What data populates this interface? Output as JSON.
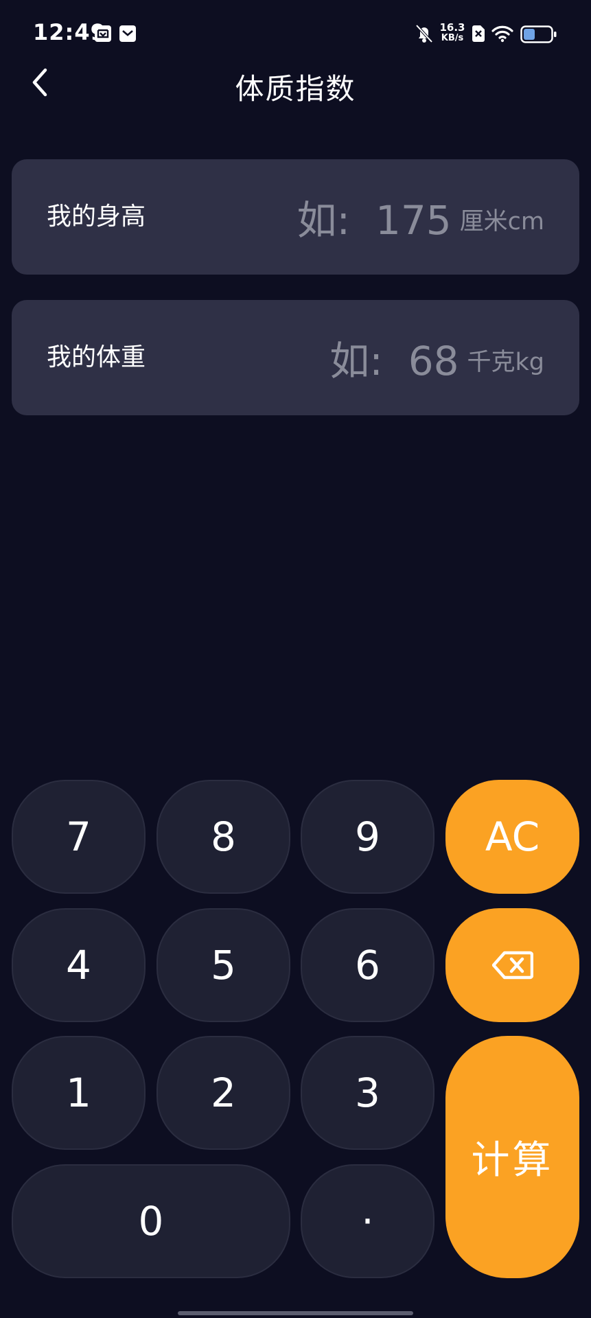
{
  "status_bar": {
    "time": "12:49",
    "net_speed_value": "16.3",
    "net_speed_unit": "KB/s"
  },
  "header": {
    "title": "体质指数"
  },
  "inputs": {
    "height": {
      "label": "我的身高",
      "placeholder": "如:  175",
      "unit": "厘米cm"
    },
    "weight": {
      "label": "我的体重",
      "placeholder": "如:  68",
      "unit": "千克kg"
    }
  },
  "keypad": {
    "keys": {
      "k7": "7",
      "k8": "8",
      "k9": "9",
      "ac": "AC",
      "k4": "4",
      "k5": "5",
      "k6": "6",
      "k1": "1",
      "k2": "2",
      "k3": "3",
      "k0": "0",
      "dot": "·",
      "calculate": "计算"
    },
    "accent_color": "#fba223",
    "key_color": "#1f2133"
  },
  "colors": {
    "background": "#0d0e21",
    "card": "#2f3046",
    "placeholder": "#8a8c9a"
  }
}
